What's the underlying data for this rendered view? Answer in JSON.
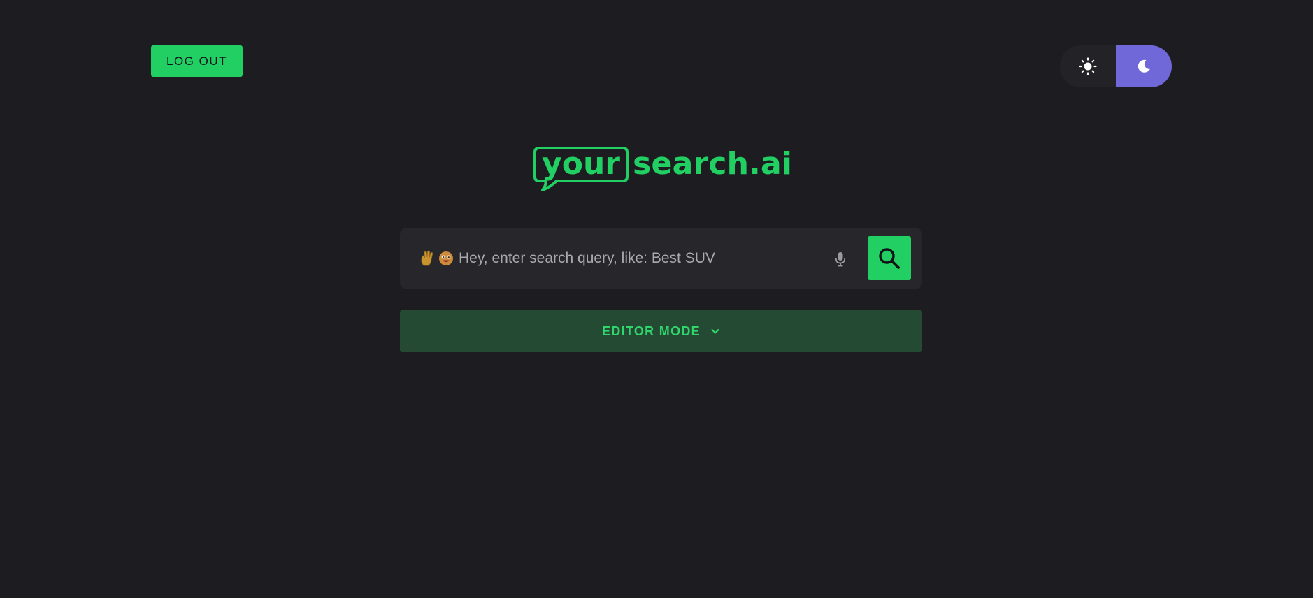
{
  "header": {
    "logout_label": "LOG OUT",
    "theme_toggle": {
      "options": [
        "light",
        "dark"
      ],
      "selected": "dark",
      "light_icon": "sun-icon",
      "dark_icon": "moon-icon"
    }
  },
  "logo": {
    "boxed_text": "your",
    "text": "search.ai"
  },
  "search": {
    "placeholder": "Hey, enter search query, like: Best SUV",
    "value": "",
    "emoji_icons": [
      "waving-hand-icon",
      "smiling-face-icon"
    ],
    "mic_icon": "microphone-icon",
    "submit_icon": "search-icon"
  },
  "editor": {
    "label": "EDITOR MODE",
    "icon": "chevron-down-icon"
  },
  "colors": {
    "background": "#1d1c21",
    "accent_green": "#22cf63",
    "toggle_active": "#7067d8",
    "editor_bg": "#254a33",
    "search_bg": "#27262b"
  }
}
